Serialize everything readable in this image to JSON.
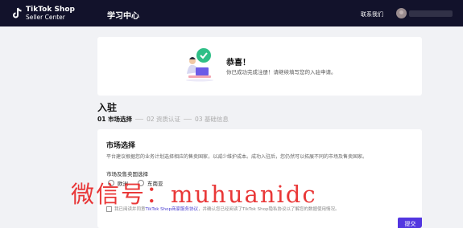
{
  "header": {
    "logo_title": "TikTok Shop",
    "logo_sub": "Seller Center",
    "nav_title": "学习中心",
    "contact": "联系我们"
  },
  "welcome": {
    "title": "恭喜！",
    "subtitle": "你已成功完成注册！请继续填写您的入驻申请。"
  },
  "onboarding": {
    "section_title": "入驻",
    "steps": [
      {
        "label": "01 市场选择"
      },
      {
        "label": "02 资质认证"
      },
      {
        "label": "03 基础信息"
      }
    ]
  },
  "market": {
    "title": "市场选择",
    "description": "平台建议根据您的业务计划选择相应的售卖国家，以减少维护成本。成功入驻后，您仍然可以拓展不同的市场及售卖国家。",
    "region_label": "市场及售卖国选择",
    "options": [
      "欧洲",
      "东南亚"
    ],
    "agreement_prefix": "我已阅读并同意",
    "agreement_link": "TikTok Shop商家服务协议",
    "agreement_suffix": "，并确认您已经阅读了TikTok Shop隐私协议以了解您的数据使用情况。",
    "submit_label": "提交"
  },
  "watermark": "微信号：muhuanidc",
  "colors": {
    "topbar": "#12122b",
    "accent": "#5236e0",
    "watermark": "#e82828"
  }
}
